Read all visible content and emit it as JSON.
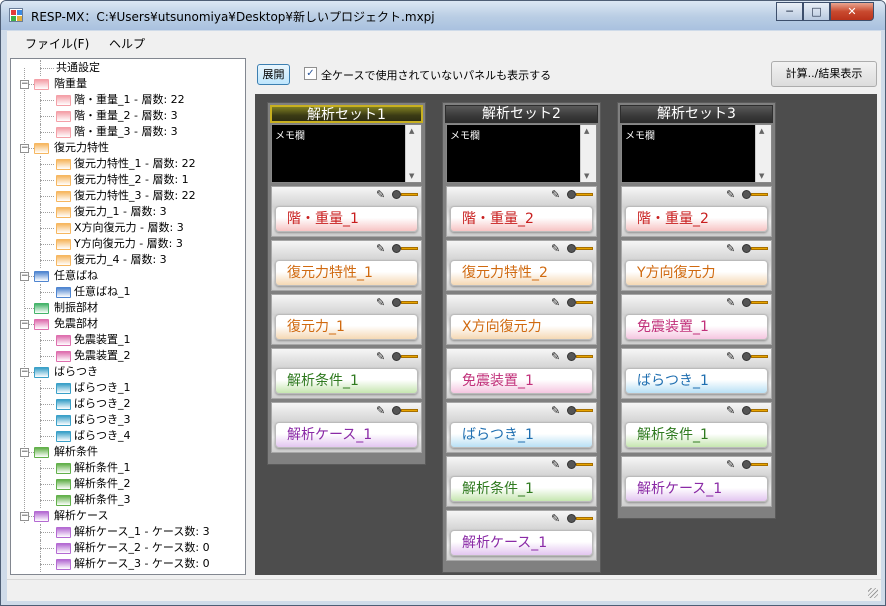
{
  "window": {
    "title": "RESP-MX：C:¥Users¥utsunomiya¥Desktop¥新しいプロジェクト.mxpj",
    "minimize_glyph": "─",
    "maximize_glyph": "□",
    "close_glyph": "✕"
  },
  "menu": {
    "file": "ファイル(F)",
    "help": "ヘルプ"
  },
  "toolbar": {
    "expand_label": "展開",
    "show_unused_checked": true,
    "show_unused_label": "全ケースで使用されていないパネルも表示する",
    "calc_label": "計算../結果表示"
  },
  "tree": [
    {
      "label": "共通設定",
      "level": 1,
      "color": ""
    },
    {
      "label": "階重量",
      "level": 0,
      "color": "#f4a0a8",
      "expanded": true
    },
    {
      "label": "階・重量_1 - 層数: 22",
      "level": 1,
      "color": "#f4a0a8"
    },
    {
      "label": "階・重量_2 - 層数: 3",
      "level": 1,
      "color": "#f4a0a8"
    },
    {
      "label": "階・重量_3 - 層数: 3",
      "level": 1,
      "color": "#f4a0a8"
    },
    {
      "label": "復元力特性",
      "level": 0,
      "color": "#f6b760",
      "expanded": true
    },
    {
      "label": "復元力特性_1 - 層数: 22",
      "level": 1,
      "color": "#f6b760"
    },
    {
      "label": "復元力特性_2 - 層数: 1",
      "level": 1,
      "color": "#f6b760"
    },
    {
      "label": "復元力特性_3 - 層数: 22",
      "level": 1,
      "color": "#f6b760"
    },
    {
      "label": "復元力_1 - 層数: 3",
      "level": 1,
      "color": "#f6b760"
    },
    {
      "label": "X方向復元力 - 層数: 3",
      "level": 1,
      "color": "#f6b760"
    },
    {
      "label": "Y方向復元力 - 層数: 3",
      "level": 1,
      "color": "#f6b760"
    },
    {
      "label": "復元力_4 - 層数: 3",
      "level": 1,
      "color": "#f6b760"
    },
    {
      "label": "任意ばね",
      "level": 0,
      "color": "#4f85d0",
      "expanded": true
    },
    {
      "label": "任意ばね_1",
      "level": 1,
      "color": "#4f85d0"
    },
    {
      "label": "制振部材",
      "level": 0,
      "color": "#45b46a",
      "expanded": false
    },
    {
      "label": "免震部材",
      "level": 0,
      "color": "#de6fae",
      "expanded": true
    },
    {
      "label": "免震装置_1",
      "level": 1,
      "color": "#de6fae"
    },
    {
      "label": "免震装置_2",
      "level": 1,
      "color": "#de6fae"
    },
    {
      "label": "ばらつき",
      "level": 0,
      "color": "#3aa0c8",
      "expanded": true
    },
    {
      "label": "ばらつき_1",
      "level": 1,
      "color": "#3aa0c8"
    },
    {
      "label": "ばらつき_2",
      "level": 1,
      "color": "#3aa0c8"
    },
    {
      "label": "ばらつき_3",
      "level": 1,
      "color": "#3aa0c8"
    },
    {
      "label": "ばらつき_4",
      "level": 1,
      "color": "#3aa0c8"
    },
    {
      "label": "解析条件",
      "level": 0,
      "color": "#62b04a",
      "expanded": true
    },
    {
      "label": "解析条件_1",
      "level": 1,
      "color": "#62b04a"
    },
    {
      "label": "解析条件_2",
      "level": 1,
      "color": "#62b04a"
    },
    {
      "label": "解析条件_3",
      "level": 1,
      "color": "#62b04a"
    },
    {
      "label": "解析ケース",
      "level": 0,
      "color": "#b46ad2",
      "expanded": true
    },
    {
      "label": "解析ケース_1 - ケース数: 3",
      "level": 1,
      "color": "#b46ad2"
    },
    {
      "label": "解析ケース_2 - ケース数: 0",
      "level": 1,
      "color": "#b46ad2"
    },
    {
      "label": "解析ケース_3 - ケース数: 0",
      "level": 1,
      "color": "#b46ad2"
    }
  ],
  "sets": [
    {
      "title": "解析セット1",
      "active": true,
      "memo": "メモ欄",
      "panels": [
        {
          "label": "階・重量_1",
          "color": "red"
        },
        {
          "label": "復元力特性_1",
          "color": "orange"
        },
        {
          "label": "復元力_1",
          "color": "orange"
        },
        {
          "label": "解析条件_1",
          "color": "green"
        },
        {
          "label": "解析ケース_1",
          "color": "purple"
        }
      ]
    },
    {
      "title": "解析セット2",
      "active": false,
      "memo": "メモ欄",
      "panels": [
        {
          "label": "階・重量_2",
          "color": "red"
        },
        {
          "label": "復元力特性_2",
          "color": "orange"
        },
        {
          "label": "X方向復元力",
          "color": "orange"
        },
        {
          "label": "免震装置_1",
          "color": "pink"
        },
        {
          "label": "ばらつき_1",
          "color": "blue"
        },
        {
          "label": "解析条件_1",
          "color": "green"
        },
        {
          "label": "解析ケース_1",
          "color": "purple"
        }
      ]
    },
    {
      "title": "解析セット3",
      "active": false,
      "memo": "メモ欄",
      "panels": [
        {
          "label": "階・重量_2",
          "color": "red"
        },
        {
          "label": "Y方向復元力",
          "color": "orange"
        },
        {
          "label": "免震装置_1",
          "color": "pink"
        },
        {
          "label": "ばらつき_1",
          "color": "blue"
        },
        {
          "label": "解析条件_1",
          "color": "green"
        },
        {
          "label": "解析ケース_1",
          "color": "purple"
        }
      ]
    }
  ],
  "icons": {
    "pencil": "✎",
    "check": "✓",
    "scroll_up": "▲",
    "scroll_down": "▼"
  }
}
